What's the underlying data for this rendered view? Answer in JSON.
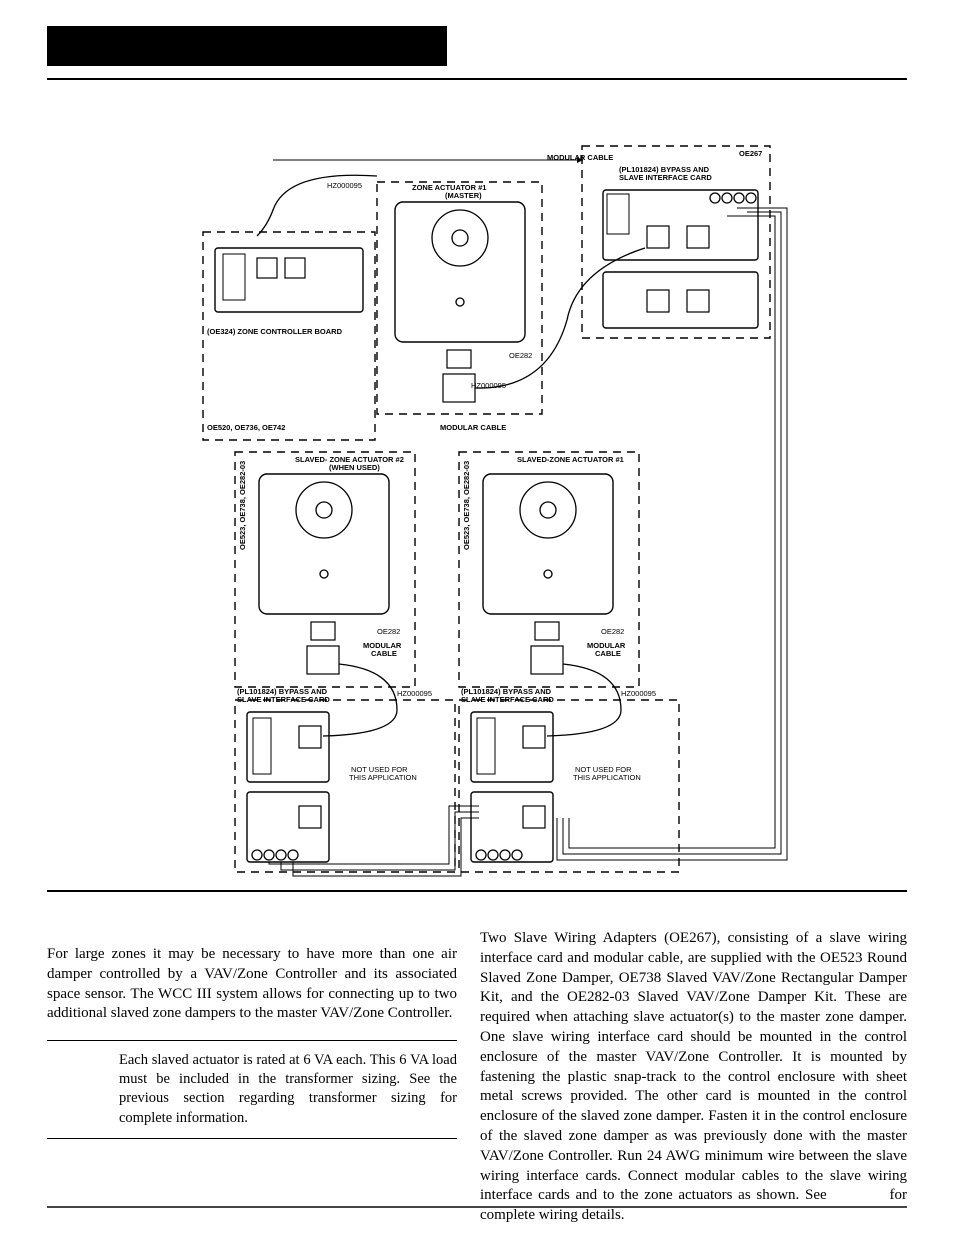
{
  "figure": {
    "topbar_label": "",
    "mod_cable_top": "MODULAR CABLE",
    "oe267": "OE267",
    "bypass_card_top": "(PL101824) BYPASS AND\nSLAVE INTERFACE CARD",
    "hz_master": "HZ000095",
    "zone_act_master": "ZONE  ACTUATOR #1\n(MASTER)",
    "zone_ctrl_board": "(OE324) ZONE CONTROLLER BOARD",
    "oe520": "OE520, OE736, OE742",
    "oe282_mid": "OE282",
    "hz_mid": "HZ000095",
    "mod_cable_mid": "MODULAR CABLE",
    "slave2_title": "SLAVED- ZONE ACTUATOR #2\n(WHEN USED)",
    "slave1_title": "SLAVED-ZONE  ACTUATOR  #1",
    "oe523_left": "OE523, OE738, OE282-03",
    "oe523_right": "OE523, OE738, OE282-03",
    "oe282_bot_l": "OE282",
    "oe282_bot_r": "OE282",
    "mod_cable_bot_l": "MODULAR\nCABLE",
    "mod_cable_bot_r": "MODULAR\nCABLE",
    "bypass_card_bot_l": "(PL101824) BYPASS AND\nSLAVE INTERFACE CARD",
    "bypass_card_bot_r": "(PL101824) BYPASS AND\nSLAVE INTERFACE CARD",
    "hz_bot_l": "HZ000095",
    "hz_bot_r": "HZ000095",
    "not_used_l": "NOT USED FOR\nTHIS APPLICATION",
    "not_used_r": "NOT USED FOR\nTHIS APPLICATION"
  },
  "text": {
    "left_para": "For large zones it may be necessary to have more than one air damper controlled by a VAV/Zone Controller and its associated space sensor. The WCC III system allows for connecting up to two additional slaved zone dampers to the master VAV/Zone Controller.",
    "note": "Each slaved actuator is rated at 6 VA each. This 6 VA load must be included in the transformer sizing. See the previous section regarding transformer sizing for complete information.",
    "right_para_a": "Two Slave Wiring Adapters (OE267), consisting of a slave wiring interface card and modular cable, are supplied with the OE523 Round Slaved Zone Damper, OE738 Slaved VAV/Zone Rectangular Damper Kit, and the OE282-03 Slaved VAV/Zone Damper Kit.  These are required when attaching slave actuator(s) to the master zone damper. One slave wiring interface card should be mounted in the control enclosure of the master VAV/Zone Controller. It is mounted  by fastening the plastic snap-track to the control enclosure with sheet metal screws provided. The other card is mounted in the control enclosure of the slaved zone damper. Fasten it in the control enclosure of the slaved zone damper as was previously done with the master VAV/Zone Controller. Run 24 AWG minimum wire between the slave wiring interface cards. Connect modular cables to the slave wiring interface cards and to the zone actuators as shown. See ",
    "right_para_b": " for complete wiring details."
  }
}
